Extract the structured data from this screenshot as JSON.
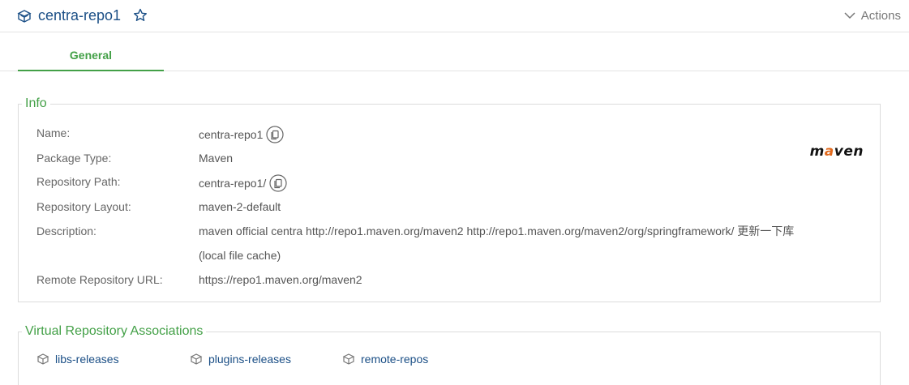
{
  "header": {
    "title": "centra-repo1",
    "actions_label": "Actions"
  },
  "tabs": [
    {
      "label": "General"
    }
  ],
  "info": {
    "legend": "Info",
    "rows": [
      {
        "label": "Name:",
        "value": "centra-repo1"
      },
      {
        "label": "Package Type:",
        "value": "Maven"
      },
      {
        "label": "Repository Path:",
        "value": "centra-repo1/"
      },
      {
        "label": "Repository Layout:",
        "value": "maven-2-default"
      },
      {
        "label": "Description:",
        "value": "maven official centra http://repo1.maven.org/maven2 http://repo1.maven.org/maven2/org/springframework/ 更新一下库 (local file cache)"
      },
      {
        "label": "Remote Repository URL:",
        "value": "https://repo1.maven.org/maven2"
      }
    ],
    "logo": {
      "prefix": "m",
      "accent": "a",
      "suffix": "ven"
    }
  },
  "virtual_associations": {
    "legend": "Virtual Repository Associations",
    "items": [
      {
        "label": "libs-releases"
      },
      {
        "label": "plugins-releases"
      },
      {
        "label": "remote-repos"
      }
    ]
  },
  "colors": {
    "accent_green": "#43a047",
    "link_blue": "#1b4f86",
    "logo_orange": "#e26a1d"
  },
  "icons": [
    "repo-icon",
    "star-icon",
    "chevron-down-icon",
    "copy-icon"
  ]
}
